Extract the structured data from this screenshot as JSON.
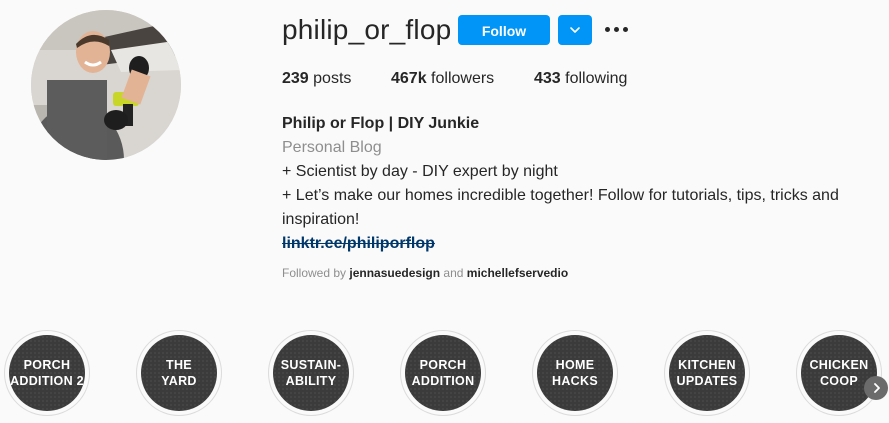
{
  "profile": {
    "username": "philip_or_flop",
    "follow_label": "Follow",
    "posts_count": "239",
    "posts_label": "posts",
    "followers_count": "467k",
    "followers_label": "followers",
    "following_count": "433",
    "following_label": "following",
    "display_name": "Philip or Flop | DIY Junkie",
    "category": "Personal Blog",
    "bio_line_1": "+ Scientist by day - DIY expert by night",
    "bio_line_2": "+ Let’s make our homes incredible together! Follow for tutorials, tips, tricks and inspiration!",
    "link": "linktr.ee/philiporflop",
    "followed_by_prefix": "Followed by",
    "followed_by_user_1": "jennasuedesign",
    "followed_by_and": "and",
    "followed_by_user_2": "michellefservedio"
  },
  "highlights": [
    {
      "label": "PORCH\nADDITION 2"
    },
    {
      "label": "THE\nYARD"
    },
    {
      "label": "SUSTAIN-\nABILITY"
    },
    {
      "label": "PORCH\nADDITION"
    },
    {
      "label": "HOME\nHACKS"
    },
    {
      "label": "KITCHEN\nUPDATES"
    },
    {
      "label": "CHICKEN\nCOOP"
    }
  ],
  "colors": {
    "accent": "#0095f6",
    "link": "#00376b",
    "muted": "#8e8e8e",
    "highlight_bg": "#3b3b3b"
  },
  "icons": {
    "dropdown": "chevron-down-icon",
    "more": "more-options-icon",
    "next": "chevron-right-icon"
  }
}
